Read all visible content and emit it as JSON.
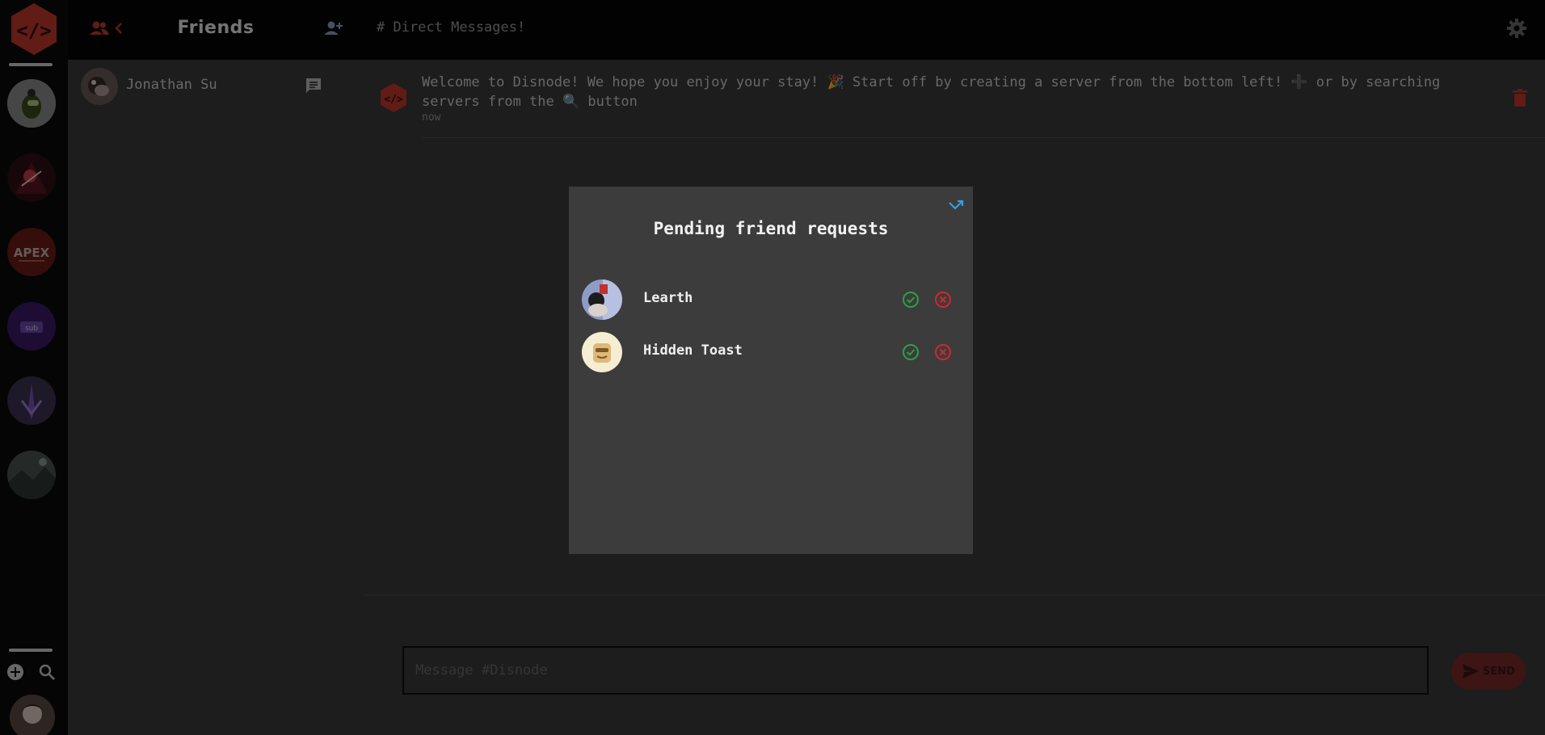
{
  "app": {
    "channel_title": "# Direct Messages!"
  },
  "rail": {
    "servers": [
      {
        "icon": "among-us-server-icon"
      },
      {
        "icon": "anime-server-icon"
      },
      {
        "icon": "apex-server-icon",
        "text": "APEX"
      },
      {
        "icon": "twitch-server-icon"
      },
      {
        "icon": "purple-server-icon"
      },
      {
        "icon": "landscape-server-icon"
      }
    ]
  },
  "friends": {
    "title": "Friends",
    "list": [
      {
        "name": "Jonathan Su"
      }
    ]
  },
  "chat": {
    "welcome_text": "Welcome to Disnode! We hope you enjoy your stay! 🎉 Start off by creating a server from the bottom left! ➕ or by searching servers from the 🔍 button",
    "welcome_time": "now",
    "composer_placeholder": "Message #Disnode",
    "send_label": "SEND"
  },
  "modal": {
    "title": "Pending friend requests",
    "requests": [
      {
        "name": "Learth"
      },
      {
        "name": "Hidden Toast"
      }
    ]
  },
  "colors": {
    "accent_red": "#c0392b",
    "accept_green": "#2e9e45",
    "decline_red": "#d0282c",
    "close_blue": "#3a9be0"
  }
}
